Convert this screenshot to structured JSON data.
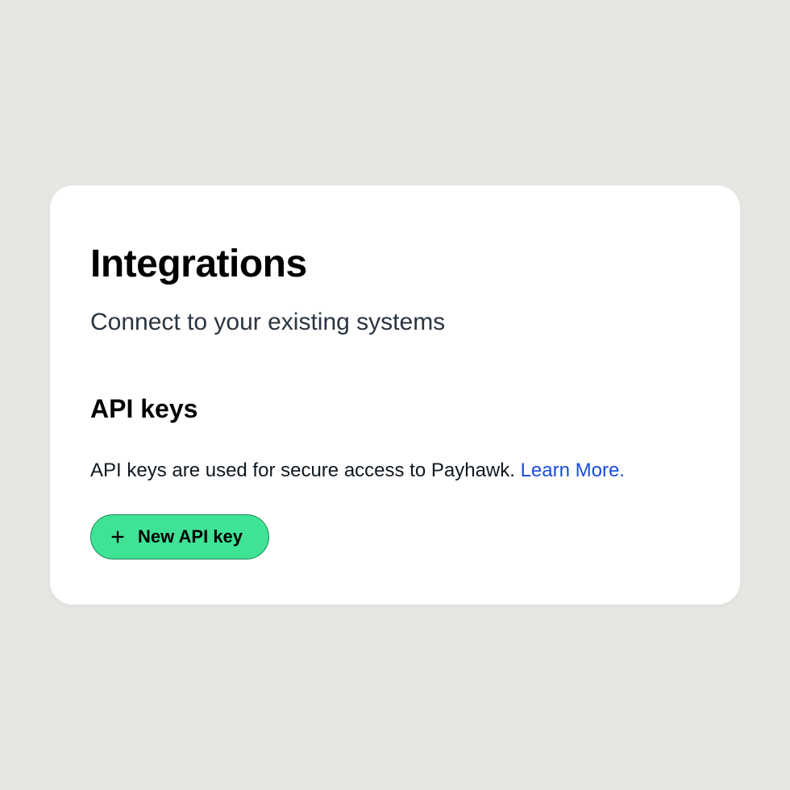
{
  "header": {
    "title": "Integrations",
    "subtitle": "Connect to your existing systems"
  },
  "section": {
    "heading": "API keys",
    "description": "API keys are used for secure access to Payhawk. ",
    "learn_more": "Learn More."
  },
  "button": {
    "label": "New API key"
  }
}
